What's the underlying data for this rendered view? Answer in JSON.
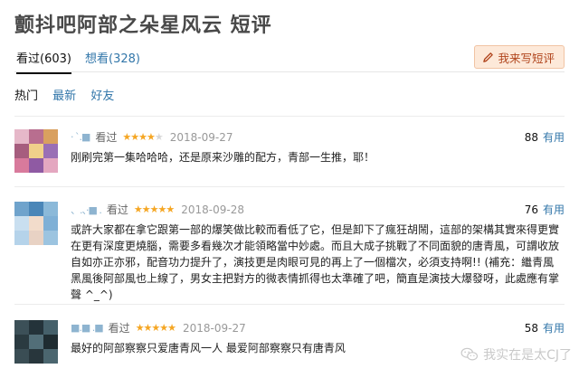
{
  "page": {
    "title": "颤抖吧阿部之朵星风云 短评"
  },
  "tabs": [
    {
      "label": "看过(603)"
    },
    {
      "label": "想看(328)"
    }
  ],
  "write_button": {
    "label": "我来写短评",
    "icon": "pencil-icon"
  },
  "subtabs": [
    {
      "label": "热门"
    },
    {
      "label": "最新"
    },
    {
      "label": "好友"
    }
  ],
  "reviews": [
    {
      "username": "· `.■",
      "status": "看过",
      "rating": 4,
      "date": "2018-09-27",
      "votes": "88",
      "useful_label": "有用",
      "content": "刚刷完第一集哈哈哈，还是原来沙雕的配方，青部一生推，耶！"
    },
    {
      "username": "、.、·■ .",
      "status": "看过",
      "rating": 5,
      "date": "2018-09-28",
      "votes": "76",
      "useful_label": "有用",
      "content": "或許大家都在拿它跟第一部的爆笑做比較而看低了它，但是卸下了瘋狂胡鬧，這部的架構其實來得更實在更有深度更燒腦，需要多看幾次才能領略當中妙處。而且大成子挑戰了不同面貌的唐青風，可謂收放自如亦正亦邪，配音功力提升了，演技更是肉眼可見的再上了一個檔次，必須支持啊!! (補充：繼青風黑風後阿部風也上線了，男女主把對方的微表情抓得也太準確了吧，簡直是演技大爆發呀，此處應有掌聲 ^_^)"
    },
    {
      "username": "■.■ .■",
      "status": "看过",
      "rating": 5,
      "date": "2018-09-27",
      "votes": "58",
      "useful_label": "有用",
      "content": "最好的阿部察察只爱唐青风一人 最爱阿部察察只有唐青风"
    }
  ],
  "watermark": {
    "text": "我实在是太CJ了",
    "icon": "wechat-icon"
  },
  "colors": {
    "link": "#3377aa",
    "star": "#f5a623",
    "button_bg": "#fde9d9",
    "button_text": "#b0441c"
  }
}
